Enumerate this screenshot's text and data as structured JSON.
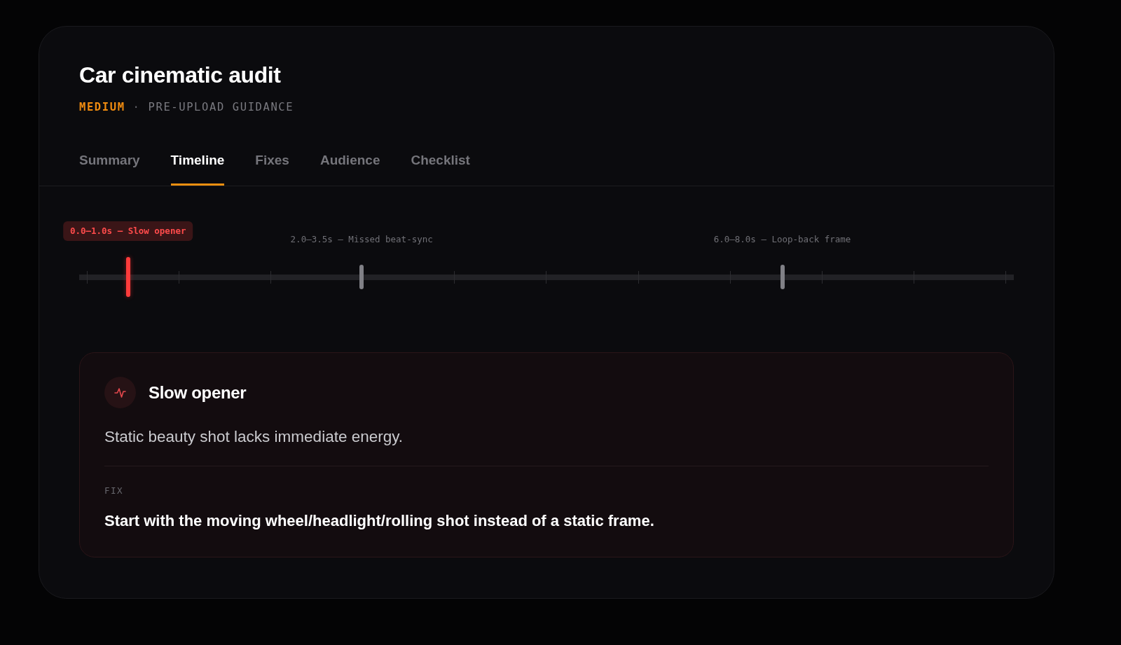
{
  "header": {
    "title": "Car cinematic audit",
    "severity": "MEDIUM",
    "separator": "·",
    "context": "PRE-UPLOAD GUIDANCE"
  },
  "tabs": [
    {
      "label": "Summary",
      "selected": false
    },
    {
      "label": "Timeline",
      "selected": true
    },
    {
      "label": "Fixes",
      "selected": false
    },
    {
      "label": "Audience",
      "selected": false
    },
    {
      "label": "Checklist",
      "selected": false
    }
  ],
  "timeline": {
    "markers": [
      {
        "label": "0.0–1.0s — Slow opener",
        "level": 0.05,
        "selected": true
      },
      {
        "label": "2.0–3.5s — Missed beat-sync",
        "level": 0.3,
        "selected": false
      },
      {
        "label": "6.0–8.0s — Loop-back frame",
        "level": 0.75,
        "selected": false
      }
    ]
  },
  "issue": {
    "title": "Slow opener",
    "description": "Static beauty shot lacks immediate energy.",
    "fix_label": "FIX",
    "fix": "Start with the moving wheel/headlight/rolling shot instead of a static frame."
  }
}
